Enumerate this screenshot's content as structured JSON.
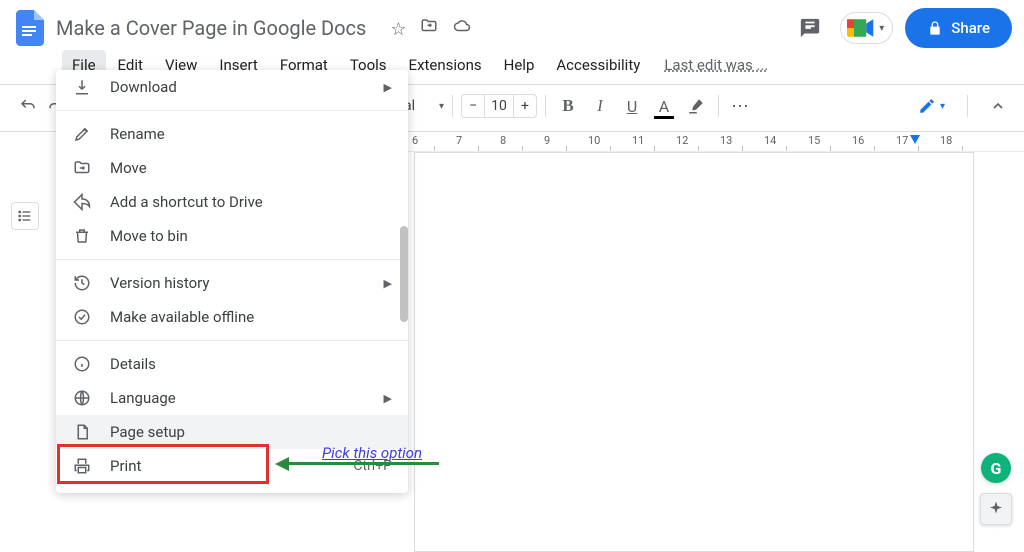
{
  "doc": {
    "title": "Make a Cover Page in Google Docs"
  },
  "menu": {
    "items": [
      "File",
      "Edit",
      "View",
      "Insert",
      "Format",
      "Tools",
      "Extensions",
      "Help",
      "Accessibility"
    ],
    "active": "File",
    "last_edit": "Last edit was ..."
  },
  "toolbar": {
    "font_name_fragment": "al",
    "font_size": "10"
  },
  "share": {
    "label": "Share"
  },
  "ruler_nums": [
    "6",
    "7",
    "8",
    "9",
    "10",
    "11",
    "12",
    "13",
    "14",
    "15",
    "16",
    "17",
    "18"
  ],
  "file_menu": {
    "download": {
      "label": "Download"
    },
    "rename": {
      "label": "Rename"
    },
    "move": {
      "label": "Move"
    },
    "shortcut": {
      "label": "Add a shortcut to Drive"
    },
    "bin": {
      "label": "Move to bin"
    },
    "version": {
      "label": "Version history"
    },
    "offline": {
      "label": "Make available offline"
    },
    "details": {
      "label": "Details"
    },
    "language": {
      "label": "Language"
    },
    "page_setup": {
      "label": "Page setup"
    },
    "print": {
      "label": "Print",
      "shortcut": "Ctrl+P"
    }
  },
  "annotation": {
    "text": "Pick this option"
  }
}
